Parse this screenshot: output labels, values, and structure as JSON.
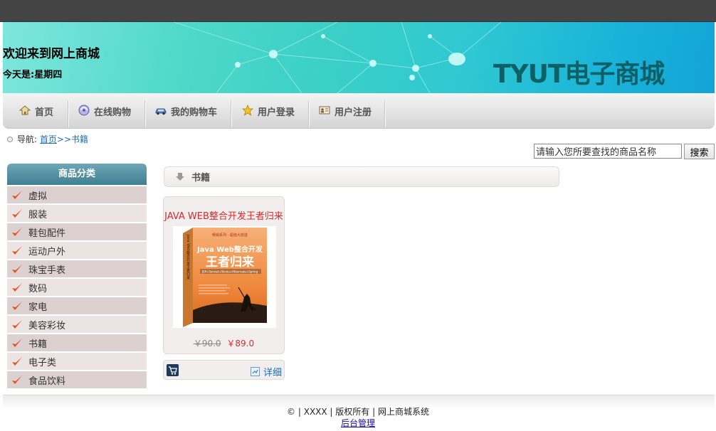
{
  "header": {
    "welcome": "欢迎来到网上商城",
    "today": "今天是:星期四",
    "brand": "TYUT电子商城"
  },
  "nav": {
    "items": [
      {
        "label": "首页",
        "icon": "home-icon"
      },
      {
        "label": "在线购物",
        "icon": "shopping-icon"
      },
      {
        "label": "我的购物车",
        "icon": "car-icon"
      },
      {
        "label": "用户登录",
        "icon": "star-icon"
      },
      {
        "label": "用户注册",
        "icon": "id-card-icon"
      }
    ]
  },
  "breadcrumb": {
    "prefix": "导航: ",
    "home": "首页",
    "separator": ">>",
    "current": "书籍"
  },
  "search": {
    "value": "请输入您所要查找的商品名称",
    "button": "搜索"
  },
  "sidebar": {
    "title": "商品分类",
    "items": [
      "虚拟",
      "服装",
      "鞋包配件",
      "运动户外",
      "珠宝手表",
      "数码",
      "家电",
      "美容彩妆",
      "书籍",
      "电子类",
      "食品饮料"
    ]
  },
  "section": {
    "title": "书籍"
  },
  "product": {
    "title": "JAVA WEB整合开发王者归来",
    "old_price": "￥90.0",
    "new_price": "￥89.0",
    "detail_label": "详细",
    "cover": {
      "series": "畅销系列 · 超值大放送",
      "line1": "Java Web整合开发",
      "line2": "王者归来",
      "subtitle": "JSP+Servlet+Struts+Hibernate+Spring",
      "spine": "Java Web整合开发王者归来"
    }
  },
  "footer": {
    "copyright": "© | XXXX | 版权所有 | 网上商城系统",
    "admin": "后台管理"
  },
  "colors": {
    "topbar": "#444444",
    "brand": "#0e5f66",
    "price_red": "#d62b2b",
    "link_blue": "#1b6fb5",
    "category_header": "#4a8a9c"
  }
}
